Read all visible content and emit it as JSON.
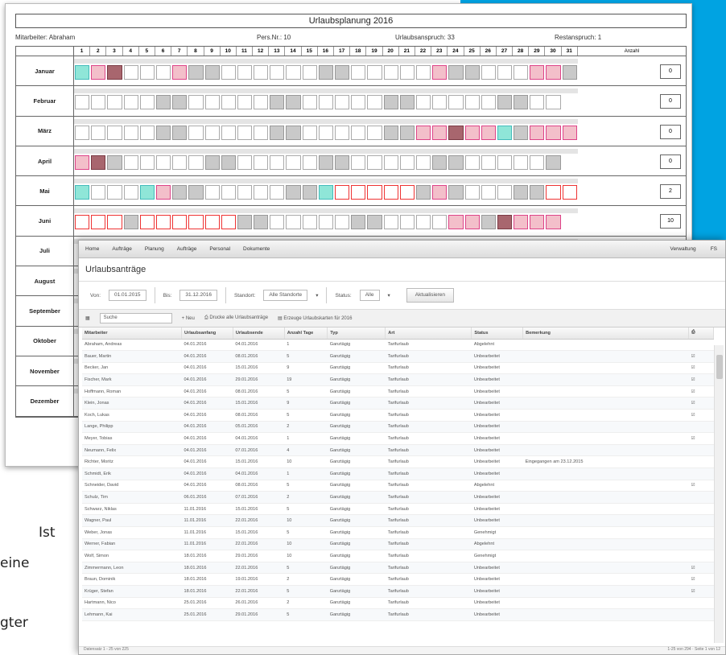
{
  "calendar": {
    "title": "Urlaubsplanung 2016",
    "meta": {
      "employee": "Mitarbeiter: Abraham",
      "pers_nr": "Pers.Nr.: 10",
      "entitlement": "Urlaubsanspruch: 33",
      "remaining": "Restanspruch: 1"
    },
    "count_header": "Anzahl",
    "months": [
      {
        "name": "Januar",
        "count": "0"
      },
      {
        "name": "Februar",
        "count": "0"
      },
      {
        "name": "März",
        "count": "0"
      },
      {
        "name": "April",
        "count": "0"
      },
      {
        "name": "Mai",
        "count": "2"
      },
      {
        "name": "Juni",
        "count": "10"
      },
      {
        "name": "Juli",
        "count": ""
      },
      {
        "name": "August",
        "count": ""
      },
      {
        "name": "September",
        "count": ""
      },
      {
        "name": "Oktober",
        "count": ""
      },
      {
        "name": "November",
        "count": ""
      },
      {
        "name": "Dezember",
        "count": ""
      }
    ],
    "colors": {
      "weekend": "#c9c9c9",
      "holiday": "#f3bfca",
      "dark": "#a8666e",
      "turquoise": "#8fe6d8"
    }
  },
  "leave_list": {
    "menu": [
      "Home",
      "Aufträge",
      "Planung",
      "Aufträge",
      "Personal",
      "Dokumente"
    ],
    "menu_right": [
      "Verwaltung",
      "FS"
    ],
    "title": "Urlaubsanträge",
    "filter": {
      "from_label": "Von:",
      "from_value": "01.01.2015",
      "to_label": "Bis:",
      "to_value": "31.12.2016",
      "location_label": "Standort:",
      "location_value": "Alle Standorte",
      "status_label": "Status:",
      "status_value": "Alle",
      "refresh": "Aktualisieren"
    },
    "toolbar": {
      "search_placeholder": "Suche",
      "new": "Neu",
      "print_all": "Drucke alle Urlaubsanträge",
      "print_cards": "Erzeuge Urlaubskarten für 2016"
    },
    "columns": [
      "Mitarbeiter",
      "Urlaubsanfang",
      "Urlaubsende",
      "Anzahl Tage",
      "Typ",
      "Art",
      "Status",
      "Bemerkung"
    ],
    "rows": [
      [
        "Abraham, Andreas",
        "04.01.2016",
        "04.01.2016",
        "1",
        "Ganztägig",
        "Tarifurlaub",
        "Abgelehnt",
        "",
        ""
      ],
      [
        "Bauer, Martin",
        "04.01.2016",
        "08.01.2016",
        "5",
        "Ganztägig",
        "Tarifurlaub",
        "Unbearbeitet",
        "",
        "☑"
      ],
      [
        "Becker, Jan",
        "04.01.2016",
        "15.01.2016",
        "9",
        "Ganztägig",
        "Tarifurlaub",
        "Unbearbeitet",
        "",
        "☑"
      ],
      [
        "Fischer, Mark",
        "04.01.2016",
        "29.01.2016",
        "19",
        "Ganztägig",
        "Tarifurlaub",
        "Unbearbeitet",
        "",
        "☑"
      ],
      [
        "Hoffmann, Roman",
        "04.01.2016",
        "08.01.2016",
        "5",
        "Ganztägig",
        "Tarifurlaub",
        "Unbearbeitet",
        "",
        "☑"
      ],
      [
        "Klein, Jonas",
        "04.01.2016",
        "15.01.2016",
        "9",
        "Ganztägig",
        "Tarifurlaub",
        "Unbearbeitet",
        "",
        "☑"
      ],
      [
        "Koch, Lukas",
        "04.01.2016",
        "08.01.2016",
        "5",
        "Ganztägig",
        "Tarifurlaub",
        "Unbearbeitet",
        "",
        "☑"
      ],
      [
        "Lange, Philipp",
        "04.01.2016",
        "05.01.2016",
        "2",
        "Ganztägig",
        "Tarifurlaub",
        "Unbearbeitet",
        "",
        ""
      ],
      [
        "Meyer, Tobias",
        "04.01.2016",
        "04.01.2016",
        "1",
        "Ganztägig",
        "Tarifurlaub",
        "Unbearbeitet",
        "",
        "☑"
      ],
      [
        "Neumann, Felix",
        "04.01.2016",
        "07.01.2016",
        "4",
        "Ganztägig",
        "Tarifurlaub",
        "Unbearbeitet",
        "",
        ""
      ],
      [
        "Richter, Moritz",
        "04.01.2016",
        "15.01.2016",
        "10",
        "Ganztägig",
        "Tarifurlaub",
        "Unbearbeitet",
        "Eingegangen am 23.12.2015",
        ""
      ],
      [
        "Schmidt, Erik",
        "04.01.2016",
        "04.01.2016",
        "1",
        "Ganztägig",
        "Tarifurlaub",
        "Unbearbeitet",
        "",
        ""
      ],
      [
        "Schneider, David",
        "04.01.2016",
        "08.01.2016",
        "5",
        "Ganztägig",
        "Tarifurlaub",
        "Abgelehnt",
        "",
        "☑"
      ],
      [
        "Schulz, Tim",
        "06.01.2016",
        "07.01.2016",
        "2",
        "Ganztägig",
        "Tarifurlaub",
        "Unbearbeitet",
        "",
        ""
      ],
      [
        "Schwarz, Niklas",
        "11.01.2016",
        "15.01.2016",
        "5",
        "Ganztägig",
        "Tarifurlaub",
        "Unbearbeitet",
        "",
        ""
      ],
      [
        "Wagner, Paul",
        "11.01.2016",
        "22.01.2016",
        "10",
        "Ganztägig",
        "Tarifurlaub",
        "Unbearbeitet",
        "",
        ""
      ],
      [
        "Weber, Jonas",
        "11.01.2016",
        "15.01.2016",
        "5",
        "Ganztägig",
        "Tarifurlaub",
        "Genehmigt",
        "",
        ""
      ],
      [
        "Werner, Fabian",
        "11.01.2016",
        "22.01.2016",
        "10",
        "Ganztägig",
        "Tarifurlaub",
        "Abgelehnt",
        "",
        ""
      ],
      [
        "Wolf, Simon",
        "18.01.2016",
        "29.01.2016",
        "10",
        "Ganztägig",
        "Tarifurlaub",
        "Genehmigt",
        "",
        ""
      ],
      [
        "Zimmermann, Leon",
        "18.01.2016",
        "22.01.2016",
        "5",
        "Ganztägig",
        "Tarifurlaub",
        "Unbearbeitet",
        "",
        "☑"
      ],
      [
        "Braun, Dominik",
        "18.01.2016",
        "19.01.2016",
        "2",
        "Ganztägig",
        "Tarifurlaub",
        "Unbearbeitet",
        "",
        "☑"
      ],
      [
        "Krüger, Stefan",
        "18.01.2016",
        "22.01.2016",
        "5",
        "Ganztägig",
        "Tarifurlaub",
        "Unbearbeitet",
        "",
        "☑"
      ],
      [
        "Hartmann, Nico",
        "25.01.2016",
        "26.01.2016",
        "2",
        "Ganztägig",
        "Tarifurlaub",
        "Unbearbeitet",
        "",
        ""
      ],
      [
        "Lehmann, Kai",
        "25.01.2016",
        "29.01.2016",
        "5",
        "Ganztägig",
        "Tarifurlaub",
        "Unbearbeitet",
        "",
        ""
      ]
    ],
    "status_left": "Datensatz 1 - 25 von 225",
    "status_right": "1-25 von 294 · Seite 1 von 12"
  },
  "page_text": {
    "line1": "Ist",
    "line2": "eine",
    "line3": "gter"
  }
}
